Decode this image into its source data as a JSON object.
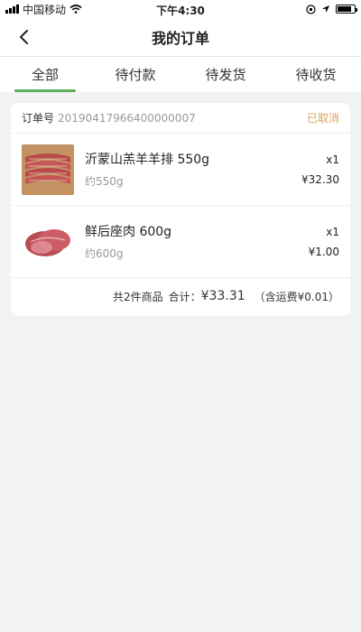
{
  "status_bar": {
    "carrier": "中国移动",
    "time": "下午4:30",
    "battery_level": 0.85
  },
  "nav": {
    "title": "我的订单"
  },
  "tabs": [
    {
      "label": "全部",
      "active": true
    },
    {
      "label": "待付款",
      "active": false
    },
    {
      "label": "待发货",
      "active": false
    },
    {
      "label": "待收货",
      "active": false
    }
  ],
  "order": {
    "number_label": "订单号",
    "number": "20190417966400000007",
    "status": "已取消",
    "items": [
      {
        "name": "沂蒙山羔羊羊排 550g",
        "spec": "约550g",
        "qty": "x1",
        "price": "¥32.30"
      },
      {
        "name": "鲜后座肉 600g",
        "spec": "约600g",
        "qty": "x1",
        "price": "¥1.00"
      }
    ],
    "summary": {
      "count_text": "共2件商品",
      "total_label": "合计：",
      "total": "¥33.31",
      "shipping": "（含运费¥0.01）"
    }
  },
  "colors": {
    "accent": "#5bb05e",
    "status": "#d8a25a"
  }
}
